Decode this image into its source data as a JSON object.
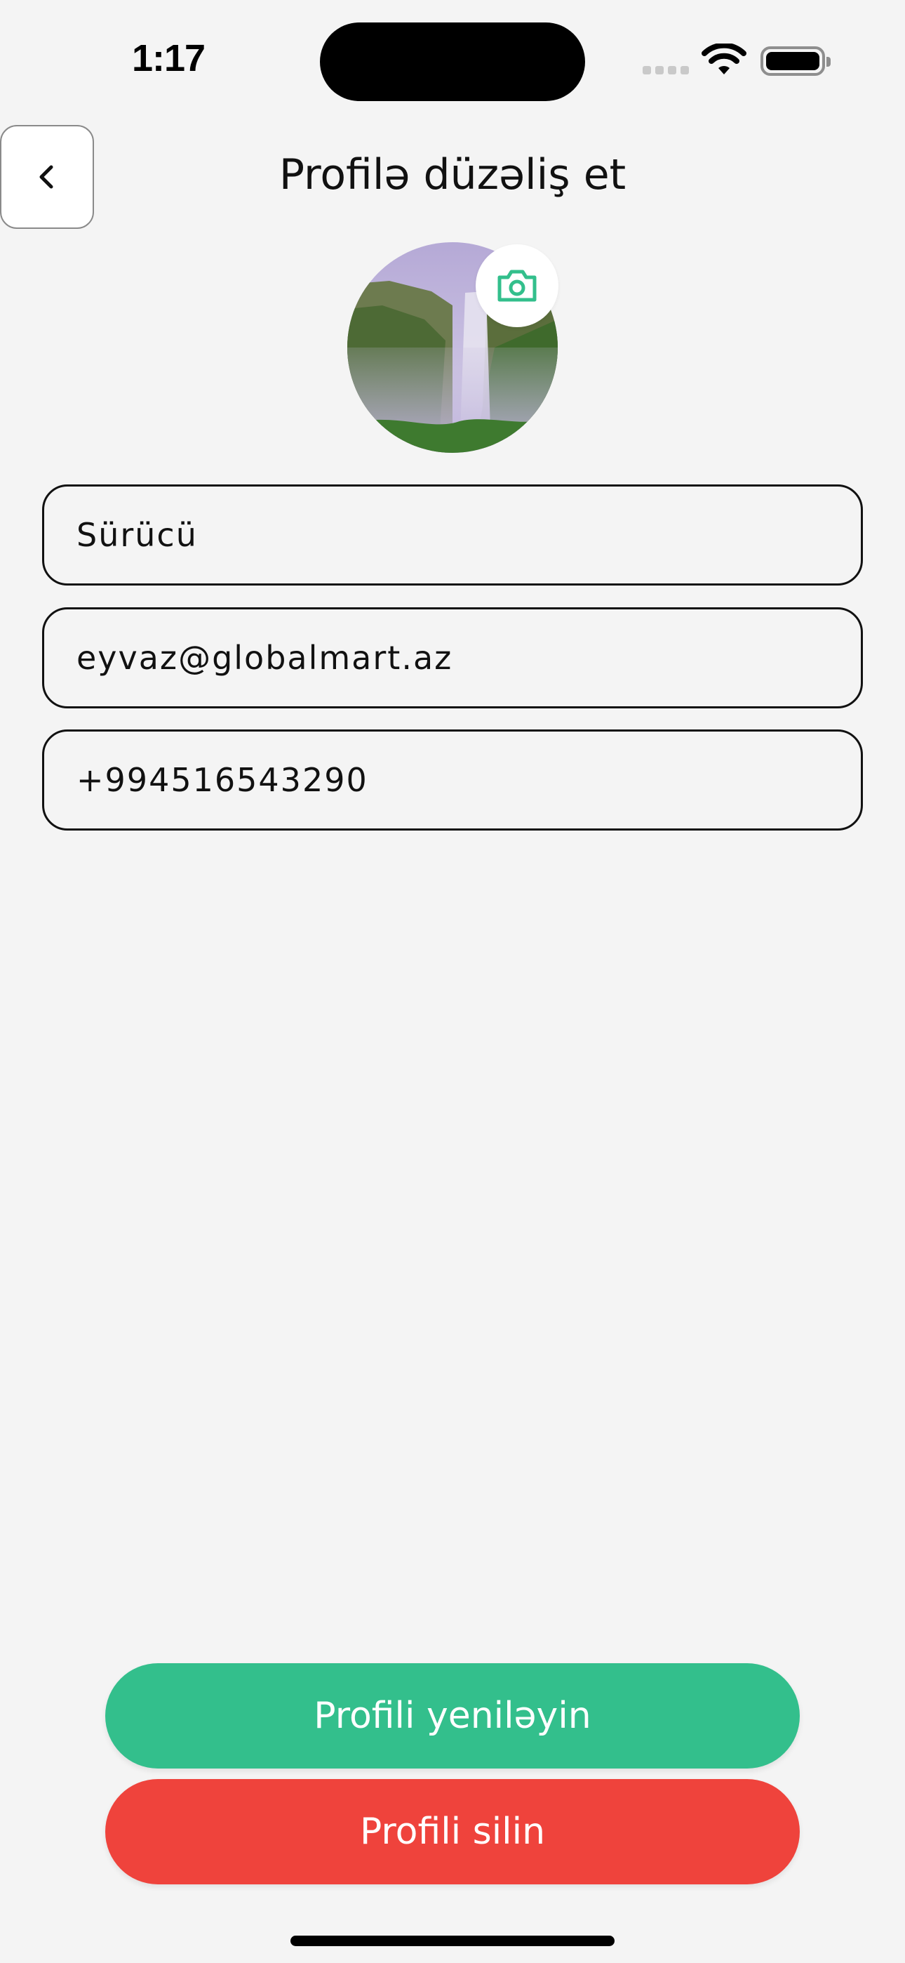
{
  "status_bar": {
    "time": "1:17"
  },
  "header": {
    "title": "Profilə düzəliş et",
    "back_icon": "chevron-left-icon"
  },
  "avatar": {
    "description_icon": "camera-icon"
  },
  "form": {
    "name_value": "Sürücü",
    "email_value": "eyvaz@globalmart.az",
    "phone_value": "+994516543290"
  },
  "actions": {
    "update_label": "Profili yeniləyin",
    "delete_label": "Profili silin"
  },
  "colors": {
    "background": "#f4f4f4",
    "accent_green": "#33bf8c",
    "danger_red": "#ef433c",
    "text": "#111111"
  }
}
